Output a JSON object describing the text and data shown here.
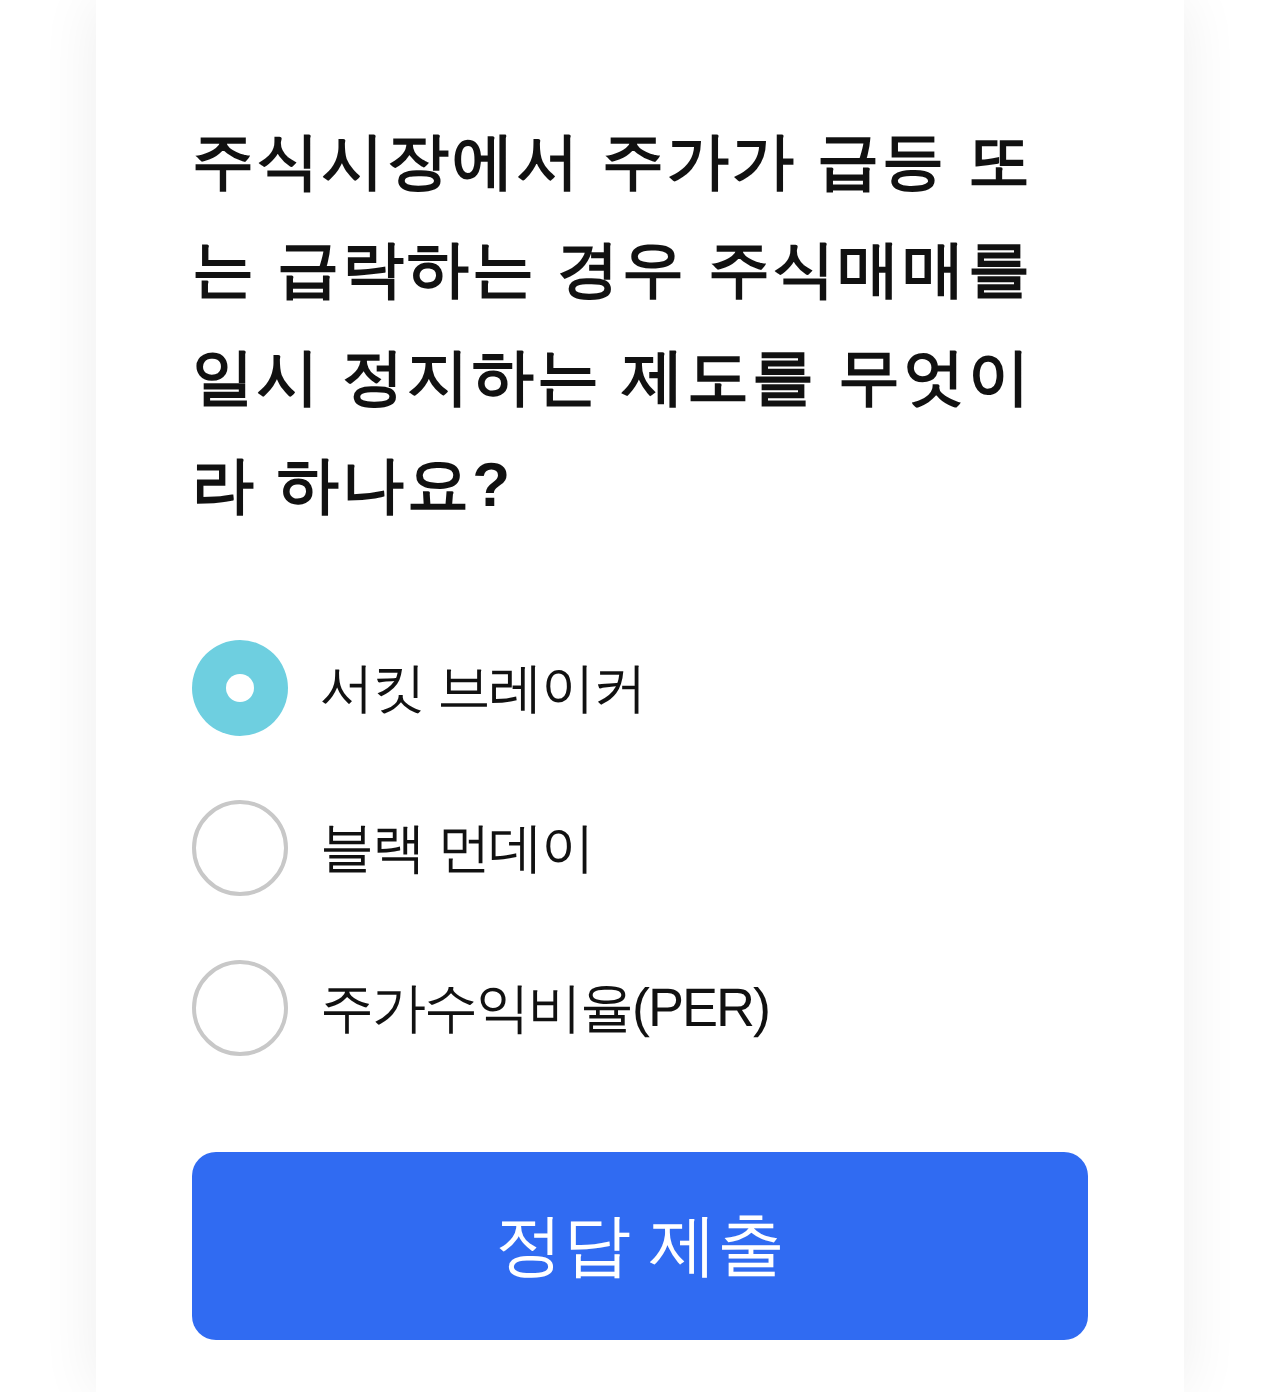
{
  "question": "주식시장에서 주가가 급등 또는 급락하는 경우 주식매매를 일시 정지하는 제도를 무엇이라 하나요?",
  "options": [
    {
      "label": "서킷 브레이커",
      "selected": true
    },
    {
      "label": "블랙 먼데이",
      "selected": false
    },
    {
      "label": "주가수익비율(PER)",
      "selected": false
    }
  ],
  "submit_button": {
    "label": "정답 제출"
  }
}
